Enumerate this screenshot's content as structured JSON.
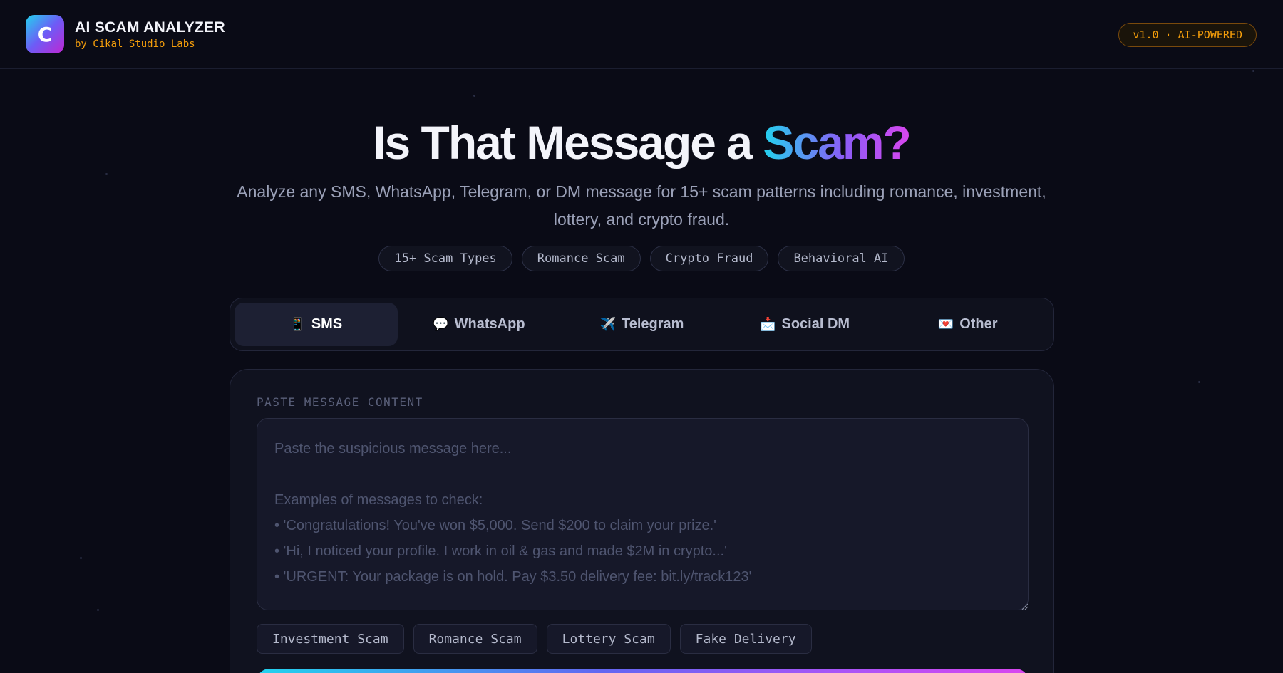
{
  "header": {
    "logo_letter": "C",
    "title": "AI SCAM ANALYZER",
    "subtitle": "by Cikal Studio Labs",
    "version_badge": "v1.0 · AI-POWERED"
  },
  "hero": {
    "title_main": "Is That Message a ",
    "title_highlight": "Scam?",
    "subtitle": "Analyze any SMS, WhatsApp, Telegram, or DM message for 15+ scam patterns including romance, investment, lottery, and crypto fraud.",
    "pills": [
      "15+ Scam Types",
      "Romance Scam",
      "Crypto Fraud",
      "Behavioral AI"
    ]
  },
  "tabs": [
    {
      "icon": "📱",
      "label": "SMS",
      "active": true
    },
    {
      "icon": "💬",
      "label": "WhatsApp",
      "active": false
    },
    {
      "icon": "✈️",
      "label": "Telegram",
      "active": false
    },
    {
      "icon": "📩",
      "label": "Social DM",
      "active": false
    },
    {
      "icon": "💌",
      "label": "Other",
      "active": false
    }
  ],
  "form": {
    "label": "PASTE MESSAGE CONTENT",
    "value": "",
    "placeholder": "Paste the suspicious message here...\n\nExamples of messages to check:\n• 'Congratulations! You've won $5,000. Send $200 to claim your prize.'\n• 'Hi, I noticed your profile. I work in oil & gas and made $2M in crypto...'\n• 'URGENT: Your package is on hold. Pay $3.50 delivery fee: bit.ly/track123'",
    "examples": [
      "Investment Scam",
      "Romance Scam",
      "Lottery Scam",
      "Fake Delivery"
    ]
  },
  "colors": {
    "accent_orange": "#f59e0b",
    "gradient_start": "#22d3ee",
    "gradient_mid": "#8b5cf6",
    "gradient_end": "#d946ef",
    "background": "#0a0b16"
  }
}
